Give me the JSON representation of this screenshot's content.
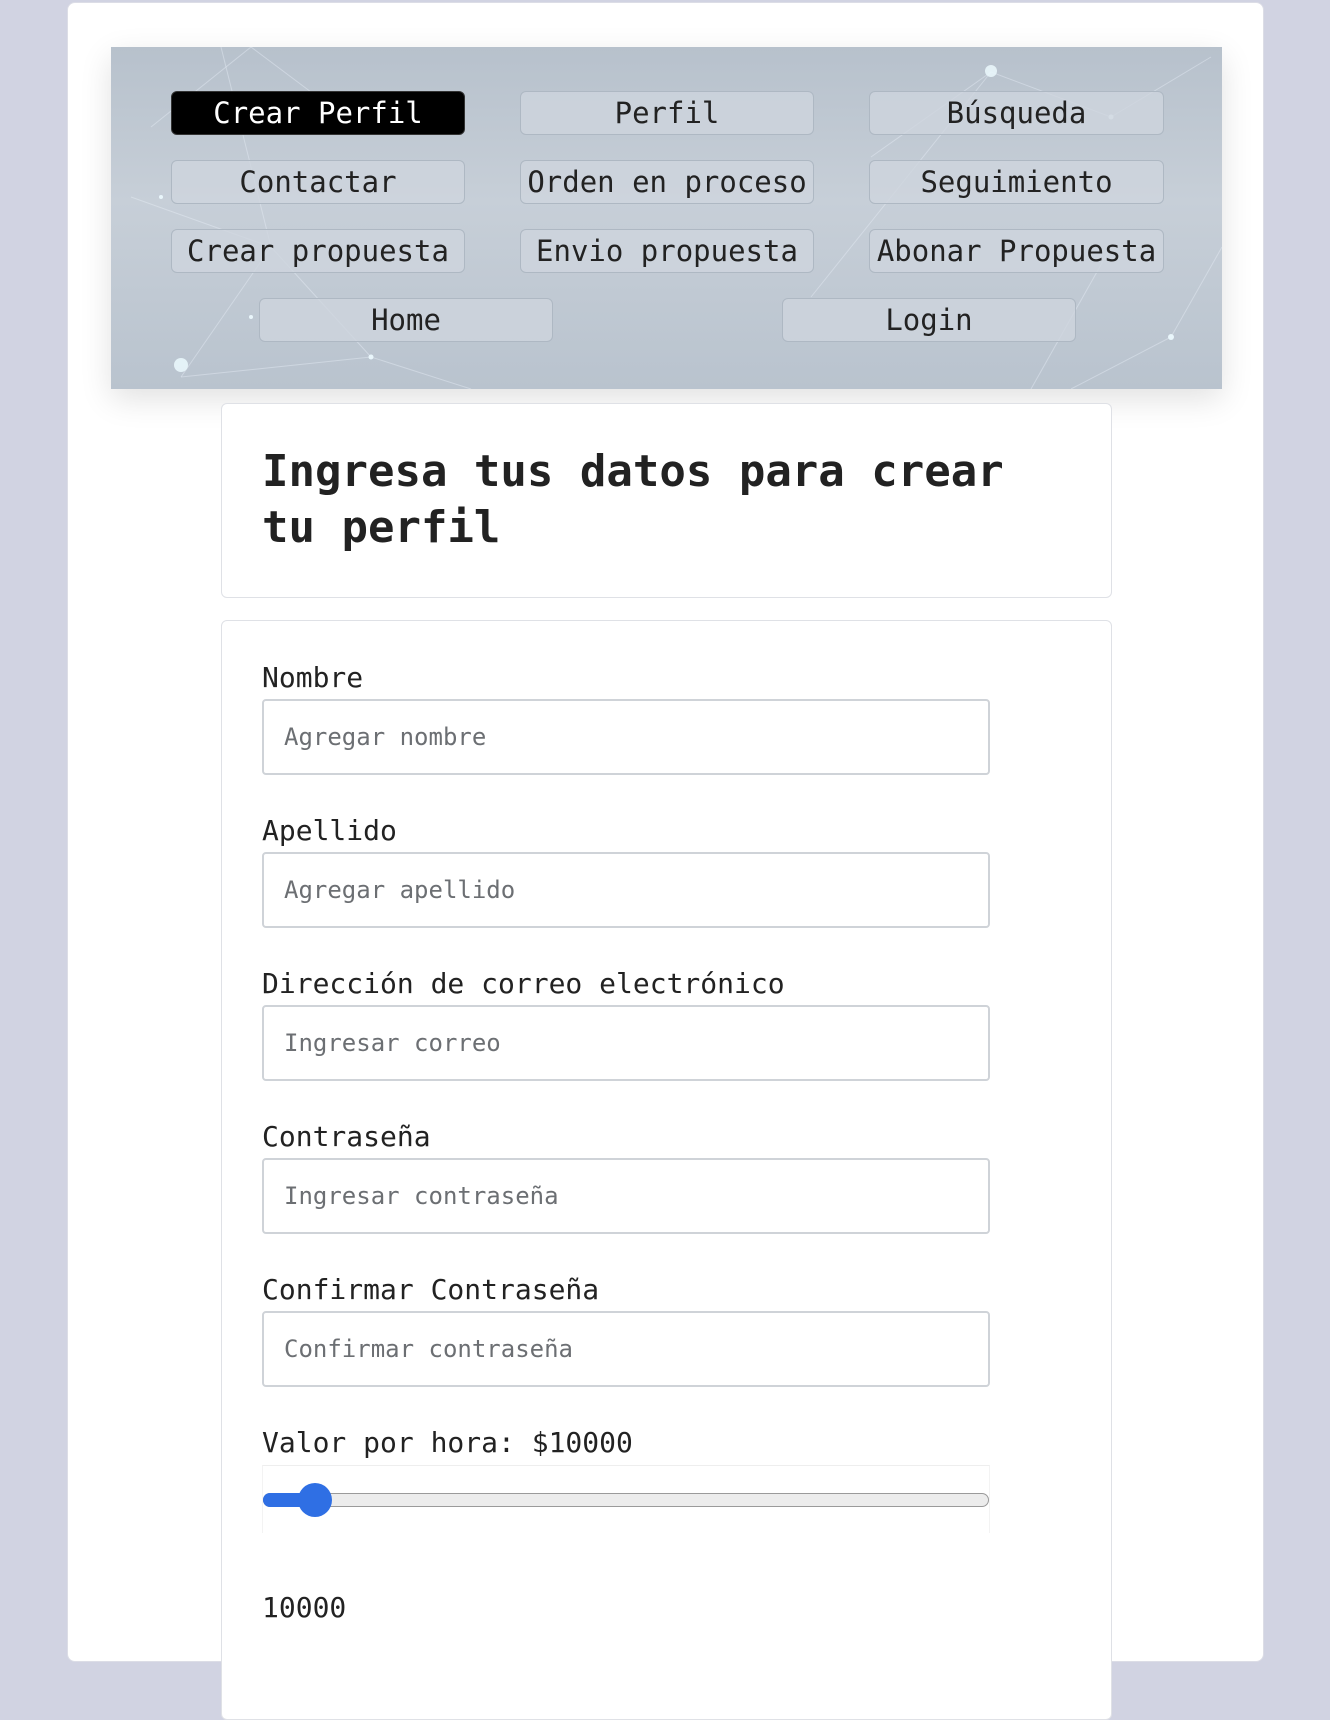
{
  "nav": {
    "buttons": [
      {
        "label": "Crear Perfil",
        "active": true
      },
      {
        "label": "Perfil"
      },
      {
        "label": "Búsqueda"
      },
      {
        "label": "Contactar"
      },
      {
        "label": "Orden en proceso"
      },
      {
        "label": "Seguimiento"
      },
      {
        "label": "Crear propuesta"
      },
      {
        "label": "Envio propuesta"
      },
      {
        "label": "Abonar Propuesta"
      },
      {
        "label": "Home"
      },
      {
        "label": "Login"
      }
    ]
  },
  "header": {
    "title": "Ingresa tus datos para crear tu perfil"
  },
  "form": {
    "nombre": {
      "label": "Nombre",
      "placeholder": "Agregar nombre"
    },
    "apellido": {
      "label": "Apellido",
      "placeholder": "Agregar apellido"
    },
    "correo": {
      "label": "Dirección de correo electrónico",
      "placeholder": "Ingresar correo"
    },
    "contrasena": {
      "label": "Contraseña",
      "placeholder": "Ingresar contraseña"
    },
    "confirmar": {
      "label": "Confirmar Contraseña",
      "placeholder": "Confirmar contraseña"
    },
    "valor_hora": {
      "label": "Valor por hora: $10000",
      "value": 10000,
      "value_text": "10000",
      "level_fraction": 0.05
    }
  },
  "colors": {
    "accent": "#2f6fe4",
    "page_background": "#d1d3e2",
    "active_nav": "#000000"
  }
}
